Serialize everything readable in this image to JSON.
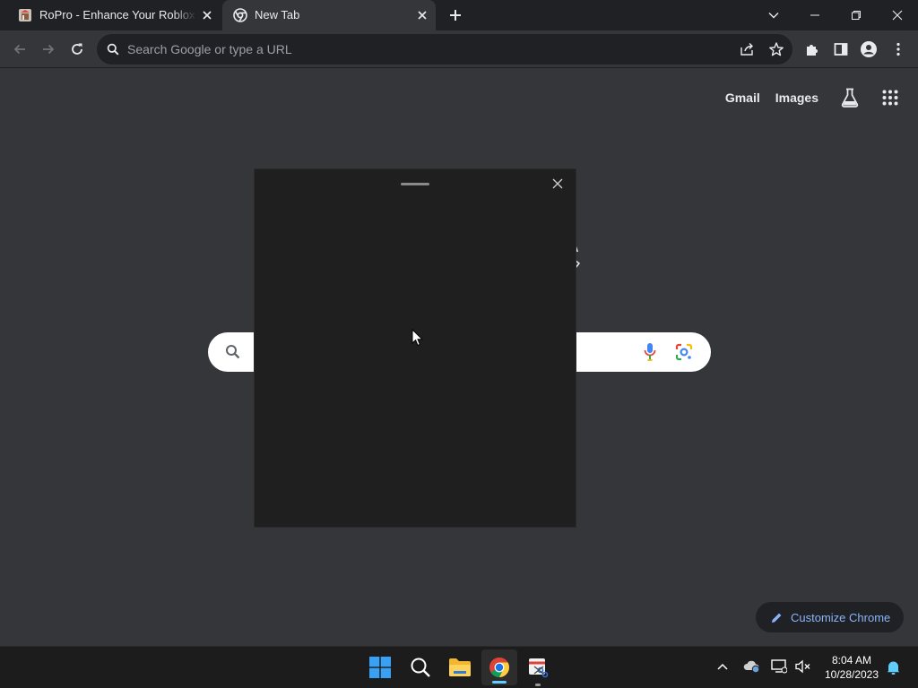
{
  "browser": {
    "tabs": [
      {
        "title": "RoPro - Enhance Your Roblox Experience",
        "favicon": "ropro-favicon",
        "active": false
      },
      {
        "title": "New Tab",
        "favicon": "chrome-favicon",
        "active": true
      }
    ],
    "omnibox": {
      "placeholder": "Search Google or type a URL",
      "value": ""
    }
  },
  "ntp": {
    "top_links": {
      "gmail": "Gmail",
      "images": "Images"
    },
    "customize_label": "Customize Chrome"
  },
  "taskbar": {
    "time": "8:04 AM",
    "date": "10/28/2023"
  },
  "colors": {
    "chrome_dark": "#202124",
    "ntp_bg": "#35363a",
    "panel_bg": "#1f1f1f",
    "accent_blue": "#8ab4f8",
    "win_blue": "#3aa0f3"
  }
}
